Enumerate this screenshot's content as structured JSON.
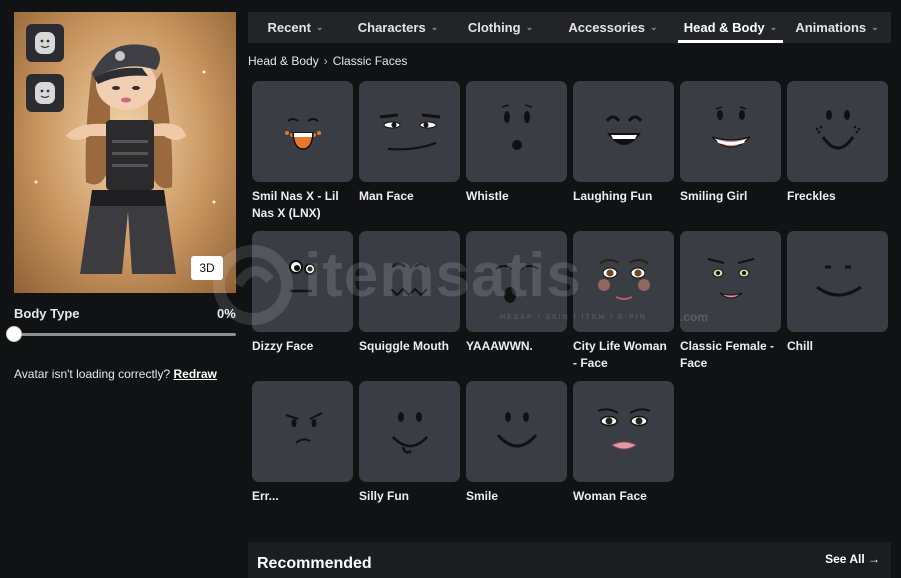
{
  "avatar_panel": {
    "view_mode_button": "3D",
    "body_type": {
      "label": "Body Type",
      "value_text": "0%",
      "value": 0
    },
    "loading_notice": {
      "text": "Avatar isn't loading correctly?",
      "link": "Redraw"
    }
  },
  "tabs": [
    {
      "label": "Recent",
      "active": false
    },
    {
      "label": "Characters",
      "active": false
    },
    {
      "label": "Clothing",
      "active": false
    },
    {
      "label": "Accessories",
      "active": false
    },
    {
      "label": "Head & Body",
      "active": true
    },
    {
      "label": "Animations",
      "active": false
    }
  ],
  "breadcrumb": {
    "parent": "Head & Body",
    "current": "Classic Faces"
  },
  "items": [
    {
      "name": "Smil Nas X - Lil Nas X (LNX)",
      "face": "lnx"
    },
    {
      "name": "Man Face",
      "face": "man"
    },
    {
      "name": "Whistle",
      "face": "whistle"
    },
    {
      "name": "Laughing Fun",
      "face": "laughing"
    },
    {
      "name": "Smiling Girl",
      "face": "smiling-girl"
    },
    {
      "name": "Freckles",
      "face": "freckles"
    },
    {
      "name": "Dizzy Face",
      "face": "dizzy"
    },
    {
      "name": "Squiggle Mouth",
      "face": "squiggle"
    },
    {
      "name": "YAAAWWN.",
      "face": "yawn"
    },
    {
      "name": "City Life Woman - Face",
      "face": "city-life"
    },
    {
      "name": "Classic Female - Face",
      "face": "classic-female"
    },
    {
      "name": "Chill",
      "face": "chill"
    },
    {
      "name": "Err...",
      "face": "err"
    },
    {
      "name": "Silly Fun",
      "face": "silly"
    },
    {
      "name": "Smile",
      "face": "smile"
    },
    {
      "name": "Woman Face",
      "face": "woman"
    }
  ],
  "recommended": {
    "title": "Recommended",
    "see_all": "See All"
  },
  "watermark": {
    "brand": "itemsatis",
    "tagline": "HESAP / SKIN / ITEM / E-PIN",
    "tld": ".com"
  },
  "colors": {
    "background": "#111214",
    "card": "#3b3d45",
    "tab_bar": "#232428",
    "accent": "#ffffff"
  }
}
